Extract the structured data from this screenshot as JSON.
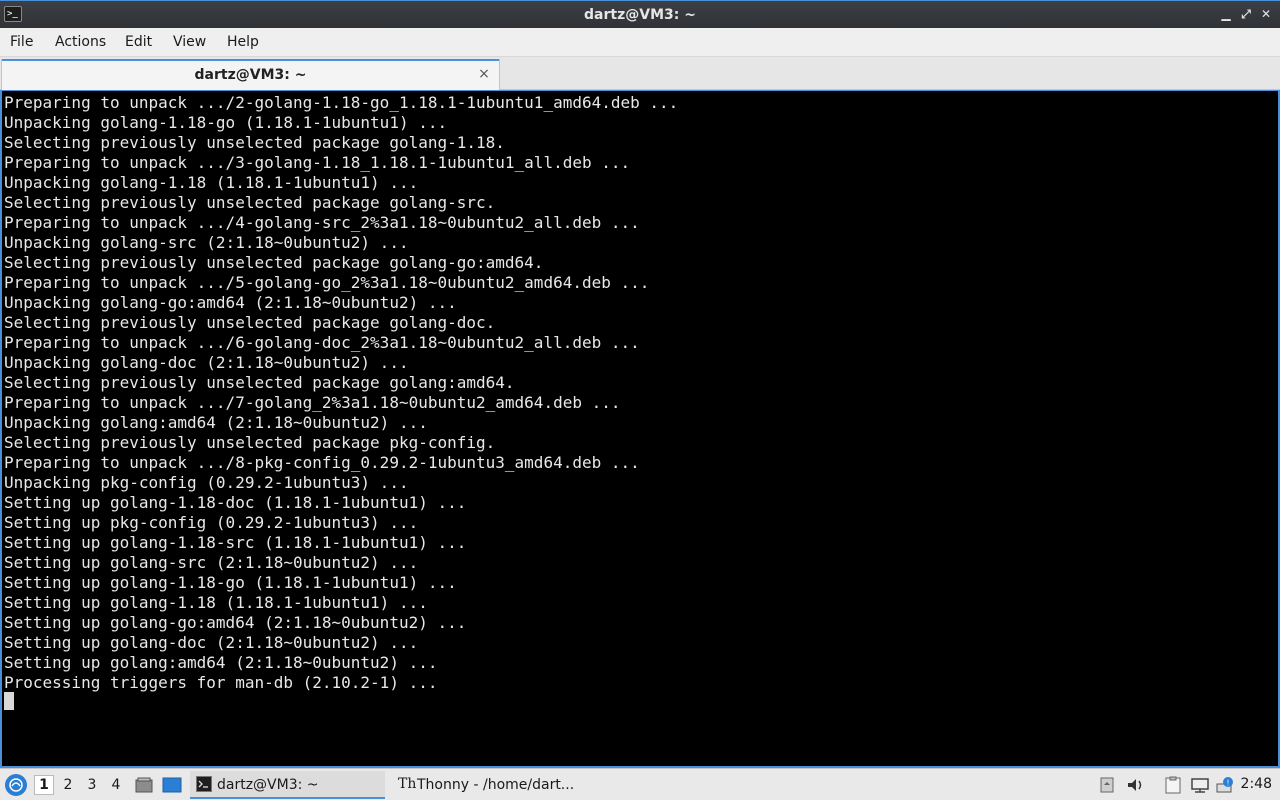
{
  "window": {
    "title": "dartz@VM3: ~",
    "icon": "terminal-icon",
    "controls": [
      "minimize-icon",
      "maximize-icon",
      "close-icon"
    ]
  },
  "menu": {
    "items": [
      "File",
      "Actions",
      "Edit",
      "View",
      "Help"
    ]
  },
  "tab": {
    "label": "dartz@VM3: ~",
    "close_glyph": "×"
  },
  "terminal": {
    "lines": [
      "Preparing to unpack .../2-golang-1.18-go_1.18.1-1ubuntu1_amd64.deb ...",
      "Unpacking golang-1.18-go (1.18.1-1ubuntu1) ...",
      "Selecting previously unselected package golang-1.18.",
      "Preparing to unpack .../3-golang-1.18_1.18.1-1ubuntu1_all.deb ...",
      "Unpacking golang-1.18 (1.18.1-1ubuntu1) ...",
      "Selecting previously unselected package golang-src.",
      "Preparing to unpack .../4-golang-src_2%3a1.18~0ubuntu2_all.deb ...",
      "Unpacking golang-src (2:1.18~0ubuntu2) ...",
      "Selecting previously unselected package golang-go:amd64.",
      "Preparing to unpack .../5-golang-go_2%3a1.18~0ubuntu2_amd64.deb ...",
      "Unpacking golang-go:amd64 (2:1.18~0ubuntu2) ...",
      "Selecting previously unselected package golang-doc.",
      "Preparing to unpack .../6-golang-doc_2%3a1.18~0ubuntu2_all.deb ...",
      "Unpacking golang-doc (2:1.18~0ubuntu2) ...",
      "Selecting previously unselected package golang:amd64.",
      "Preparing to unpack .../7-golang_2%3a1.18~0ubuntu2_amd64.deb ...",
      "Unpacking golang:amd64 (2:1.18~0ubuntu2) ...",
      "Selecting previously unselected package pkg-config.",
      "Preparing to unpack .../8-pkg-config_0.29.2-1ubuntu3_amd64.deb ...",
      "Unpacking pkg-config (0.29.2-1ubuntu3) ...",
      "Setting up golang-1.18-doc (1.18.1-1ubuntu1) ...",
      "Setting up pkg-config (0.29.2-1ubuntu3) ...",
      "Setting up golang-1.18-src (1.18.1-1ubuntu1) ...",
      "Setting up golang-src (2:1.18~0ubuntu2) ...",
      "Setting up golang-1.18-go (1.18.1-1ubuntu1) ...",
      "Setting up golang-1.18 (1.18.1-1ubuntu1) ...",
      "Setting up golang-go:amd64 (2:1.18~0ubuntu2) ...",
      "Setting up golang-doc (2:1.18~0ubuntu2) ...",
      "Setting up golang:amd64 (2:1.18~0ubuntu2) ...",
      "Processing triggers for man-db (2.10.2-1) ..."
    ]
  },
  "taskbar": {
    "workspaces": [
      "1",
      "2",
      "3",
      "4"
    ],
    "active_workspace": "1",
    "tasks": [
      {
        "label": "dartz@VM3: ~",
        "icon": "terminal-icon",
        "active": true
      },
      {
        "label": "Thonny  -  /home/dart...",
        "icon": "thonny-icon",
        "active": false
      }
    ],
    "tray": [
      "storage-icon",
      "volume-icon",
      "clipboard-icon",
      "network-icon",
      "update-notifier-icon"
    ],
    "clock": "2:48",
    "accent": "#4a90d9"
  }
}
